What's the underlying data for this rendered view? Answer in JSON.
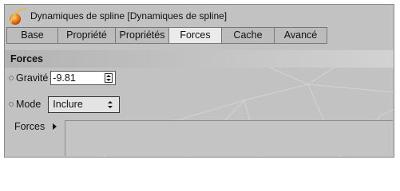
{
  "window": {
    "title": "Dynamiques de spline [Dynamiques de spline]"
  },
  "tabs": [
    {
      "label": "Base"
    },
    {
      "label": "Propriété"
    },
    {
      "label": "Propriétés"
    },
    {
      "label": "Forces"
    },
    {
      "label": "Cache"
    },
    {
      "label": "Avancé"
    }
  ],
  "active_tab": "Forces",
  "section": {
    "title": "Forces"
  },
  "gravity": {
    "label": "Gravité",
    "value": "-9.81"
  },
  "mode": {
    "label": "Mode",
    "value": "Inclure"
  },
  "forces_list": {
    "label": "Forces"
  },
  "icons": {
    "app": "spline-dynamics-icon",
    "spinner": "spinner-arrows-icon",
    "expand": "triangle-right-icon"
  },
  "colors": {
    "active_tab": "#ebebeb",
    "panel": "#c2c2c2",
    "icon_orange": "#f07a10"
  }
}
